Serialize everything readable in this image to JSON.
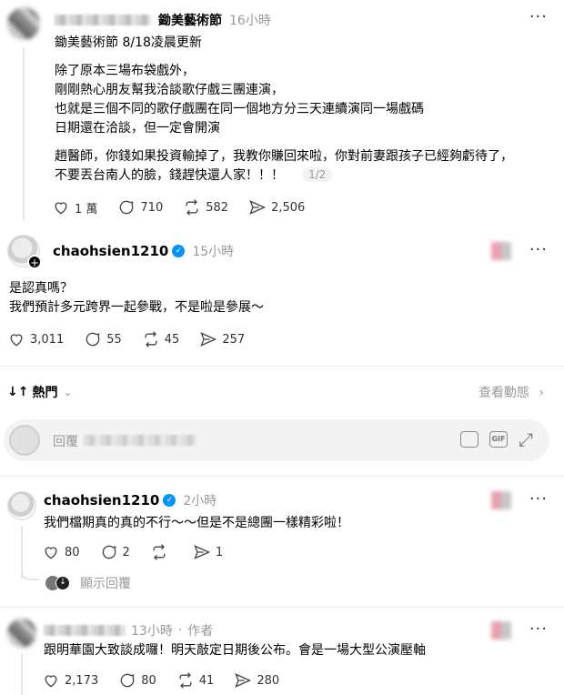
{
  "post1": {
    "author": "鋤美藝術節",
    "time": "16小時",
    "lines": [
      "鋤美藝術節 8/18凌晨更新",
      "除了原本三場布袋戲外，",
      "剛剛熱心朋友幫我洽談歌仔戲三團連演，",
      "也就是三個不同的歌仔戲團在同一個地方分三天連續演同一場戲碼",
      "日期還在洽談，但一定會開演",
      "趙醫師，你錢如果投資輸掉了，我教你賺回來啦，你對前妻跟孩子已經夠虧待了，",
      "不要丟台南人的臉，錢趕快還人家！！！"
    ],
    "page_badge": "1/2",
    "likes": "1 萬",
    "comments": "710",
    "reposts": "582",
    "shares": "2,506"
  },
  "post2": {
    "author": "chaohsien1210",
    "time": "15小時",
    "lines": [
      "是認真嗎？",
      "我們預計多元跨界一起參戰，不是啦是參展～"
    ],
    "likes": "3,011",
    "comments": "55",
    "reposts": "45",
    "shares": "257"
  },
  "sort": {
    "label": "熱門",
    "activity": "查看動態"
  },
  "reply_box": {
    "placeholder": "回覆"
  },
  "reply1": {
    "author": "chaohsien1210",
    "time": "2小時",
    "text": "我們檔期真的真的不行～～但是不是總團一樣精彩啦！",
    "likes": "80",
    "comments": "2",
    "reposts": "",
    "shares": "1",
    "show_replies": "顯示回覆"
  },
  "reply2": {
    "time": "13小時",
    "author_tag": "作者",
    "text": "跟明華園大致談成囉！明天敲定日期後公布。會是一場大型公演壓軸",
    "likes": "2,173",
    "comments": "80",
    "reposts": "41",
    "shares": "280"
  },
  "colors": {
    "verified": "#0095f6",
    "muted": "#999999",
    "divider": "#ececec"
  }
}
